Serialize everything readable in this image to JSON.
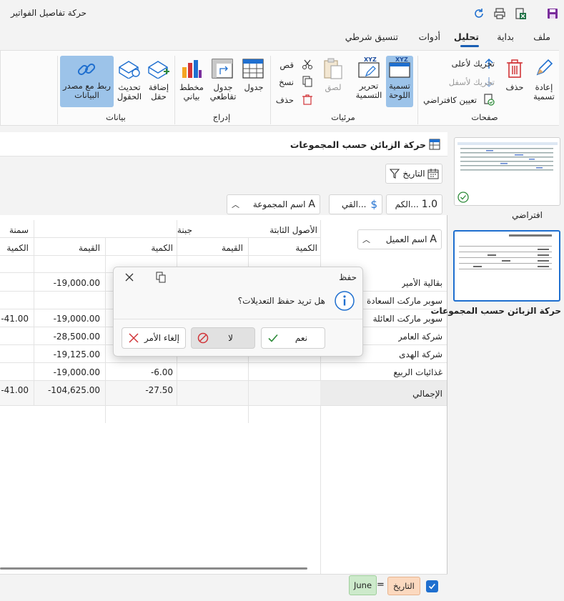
{
  "app": {
    "title": "حركة تفاصيل الفواتير"
  },
  "menu": {
    "tabs": [
      "ملف",
      "بداية",
      "تحليل",
      "أدوات",
      "تنسيق شرطي"
    ],
    "active": "تحليل"
  },
  "ribbon": {
    "pages": {
      "label": "صفحات",
      "rename": [
        "إعادة",
        "تسمية"
      ],
      "delete": "حذف",
      "move_up": "تحريك لأعلى",
      "move_down": "تحريك لأسفل",
      "set_default": "تعيين كافتراضي"
    },
    "visuals": {
      "label": "مرئيات",
      "canvas_label": [
        "تسمية",
        "اللوحة"
      ],
      "edit_label": [
        "تحرير",
        "التسمية"
      ],
      "paste": "لصق",
      "cut": "قص",
      "copy": "نسخ",
      "delete": "حذف",
      "xyz": "XYZ"
    },
    "insert": {
      "label": "إدراج",
      "table": "جدول",
      "pivot": [
        "جدول",
        "تقاطعي"
      ],
      "chart": [
        "مخطط",
        "بياني"
      ]
    },
    "data": {
      "label": "بيانات",
      "add_field": [
        "إضافة",
        "حقل"
      ],
      "refresh": [
        "تحديث",
        "الحقول"
      ],
      "link": [
        "ربط مع مصدر",
        "البيانات"
      ]
    }
  },
  "report": {
    "title": "حركة الزبائن حسب المجموعات",
    "filter_chip": "التاريخ",
    "value_chips": [
      "الكم...",
      "القي...",
      "اسم المجموعة"
    ],
    "row_chip": "اسم العميل",
    "col_groups": [
      "الأصول الثابتة",
      "جبنة",
      "سمنة"
    ],
    "col_headers": [
      "الكمية",
      "القيمة",
      "الكمية",
      "القيمة",
      "الكمية"
    ],
    "rows": [
      {
        "name": "بقالية الأمير",
        "c1": "",
        "c2": "",
        "c3": "",
        "c4": "-19,000.00",
        "c5": ""
      },
      {
        "name": "سوبر ماركت السعادة",
        "c1": "",
        "c2": "",
        "c3": "",
        "c4": "",
        "c5": ""
      },
      {
        "name": "سوبر ماركت العائلة",
        "c1": "",
        "c2": "",
        "c3": "",
        "c4": "-19,000.00",
        "c5": "-41.00"
      },
      {
        "name": "شركة العامر",
        "c1": "",
        "c2": "",
        "c3": "",
        "c4": "-28,500.00",
        "c5": ""
      },
      {
        "name": "شركة الهدى",
        "c1": "",
        "c2": "",
        "c3": "",
        "c4": "-19,125.00",
        "c5": ""
      },
      {
        "name": "غذائيات الربيع",
        "c1": "",
        "c2": "",
        "c3": "-6.00",
        "c4": "-19,000.00",
        "c5": ""
      }
    ],
    "total": {
      "name": "الإجمالي",
      "c1": "",
      "c2": "",
      "c3": "-27.50",
      "c4": "-104,625.00",
      "c5": "-41.00"
    },
    "filter_bar": {
      "field": "التاريخ",
      "op": "=",
      "value": "June",
      "checked": true
    }
  },
  "dialog": {
    "title": "حفظ",
    "message": "هل تريد حفظ التعديلات؟",
    "yes": "نعم",
    "no": "لا",
    "cancel": "إلغاء الأمر"
  },
  "pages_panel": {
    "items": [
      {
        "label": "افتراضي"
      },
      {
        "label": "حركة الزبائن حسب المجموعات"
      }
    ]
  },
  "colors": {
    "accent": "#1f6fcf",
    "selected_button": "#9cc3e9",
    "delete_red": "#d13438"
  }
}
